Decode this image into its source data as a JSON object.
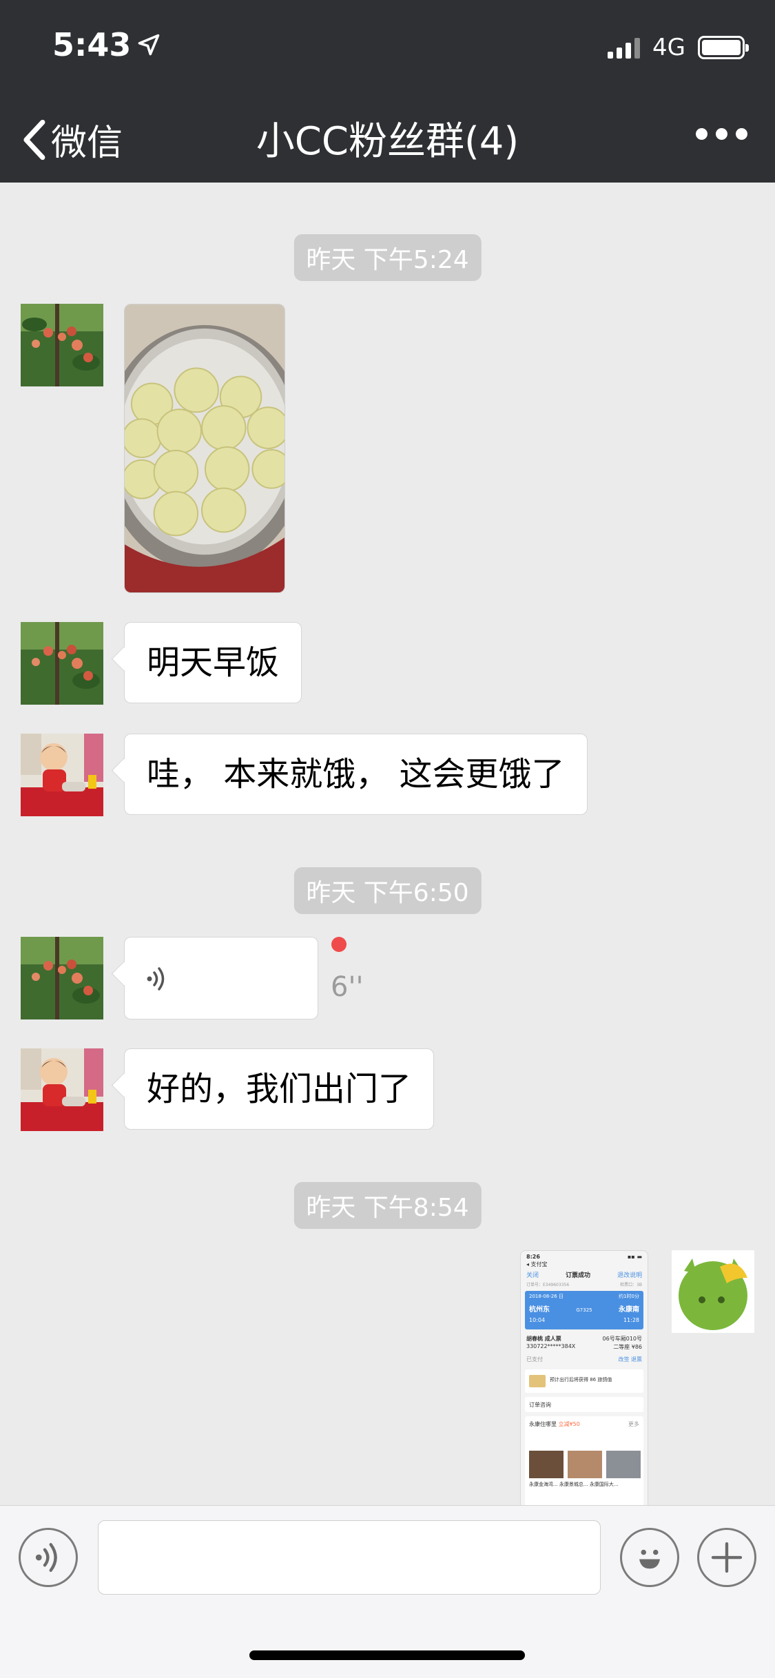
{
  "status_bar": {
    "time": "5:43",
    "network": "4G"
  },
  "nav": {
    "back_label": "微信",
    "title": "小CC粉丝群(4)"
  },
  "messages": {
    "time_1": "昨天 下午5:24",
    "text_1": "明天早饭",
    "text_2": "哇， 本来就饿， 这会更饿了",
    "time_2": "昨天 下午6:50",
    "voice_duration": "6''",
    "text_3": "好的，我们出门了",
    "time_3": "昨天 下午8:54"
  },
  "screenshot_thumb": {
    "status_time": "8:26",
    "back_app": "◂ 支付宝",
    "close": "关闭",
    "page_title": "订票成功",
    "refund": "退改说明",
    "order_no": "订单号：E349603356",
    "check": "检票口：3B",
    "date": "2018-08-26 日",
    "duration": "约1时0分",
    "from_station": "杭州东",
    "to_station": "永康南",
    "train": "G7325",
    "depart": "10:04",
    "arrive": "11:28",
    "passenger": "胡春桃 成人票",
    "seat": "06号车厢010号",
    "id_no": "330722*****384X",
    "seat_class": "二等座 ¥86",
    "paid": "已支付",
    "btn_change": "改签",
    "btn_refund": "退票",
    "reward": "预计出行后将获得 86 旅鸽值",
    "consult": "订单咨询",
    "hotel_section": "永康住哪里",
    "hotel_tag": "立减¥50",
    "more": "更多",
    "hotel_1": "永康金海湾...",
    "hotel_2": "永康景城总...",
    "hotel_3": "永康国际大..."
  },
  "colors": {
    "header_bg": "#2e3033",
    "chat_bg": "#ebebeb",
    "unread_dot": "#f04b4b"
  }
}
